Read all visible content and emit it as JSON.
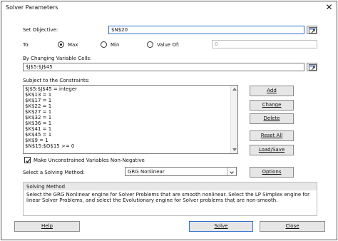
{
  "dialog": {
    "title": "Solver Parameters",
    "close_glyph": "✕"
  },
  "objective": {
    "label": "Set Objective:",
    "value": "$N$20"
  },
  "to": {
    "label": "To:",
    "options": [
      {
        "label": "Max",
        "selected": true
      },
      {
        "label": "Min",
        "selected": false
      },
      {
        "label": "Value Of:",
        "selected": false
      }
    ],
    "value_of": "0"
  },
  "changing": {
    "label": "By Changing Variable Cells:",
    "value": "$J$5:$J$45"
  },
  "constraints": {
    "label": "Subject to the Constraints:",
    "items": [
      "$J$5:$J$45 = integer",
      "$K$13 = 1",
      "$K$17 = 1",
      "$K$22 = 1",
      "$K$27 = 1",
      "$K$32 = 1",
      "$K$36 = 1",
      "$K$41 = 1",
      "$K$45 = 1",
      "$K$9 = 1",
      "$N$15:$O$15 >= 0"
    ]
  },
  "side_buttons": {
    "add": "Add",
    "change": "Change",
    "delete": "Delete",
    "reset_all": "Reset All",
    "load_save": "Load/Save"
  },
  "nonneg": {
    "label": "Make Unconstrained Variables Non-Negative",
    "checked": true
  },
  "method": {
    "label": "Select a Solving Method:",
    "selected": "GRG Nonlinear",
    "options_button": "Options",
    "box_title": "Solving Method",
    "description": "Select the GRG Nonlinear engine for Solver Problems that are smooth nonlinear. Select the LP Simplex engine for linear Solver Problems, and select the Evolutionary engine for Solver problems that are non-smooth."
  },
  "footer": {
    "help": "Help",
    "solve": "Solve",
    "close": "Close"
  },
  "colors": {
    "focus_border": "#2f6fd1",
    "button_face": "#e6e6e6"
  },
  "icons": [
    "close-icon",
    "range-select-icon",
    "checkmark-icon",
    "chevron-down-icon"
  ]
}
